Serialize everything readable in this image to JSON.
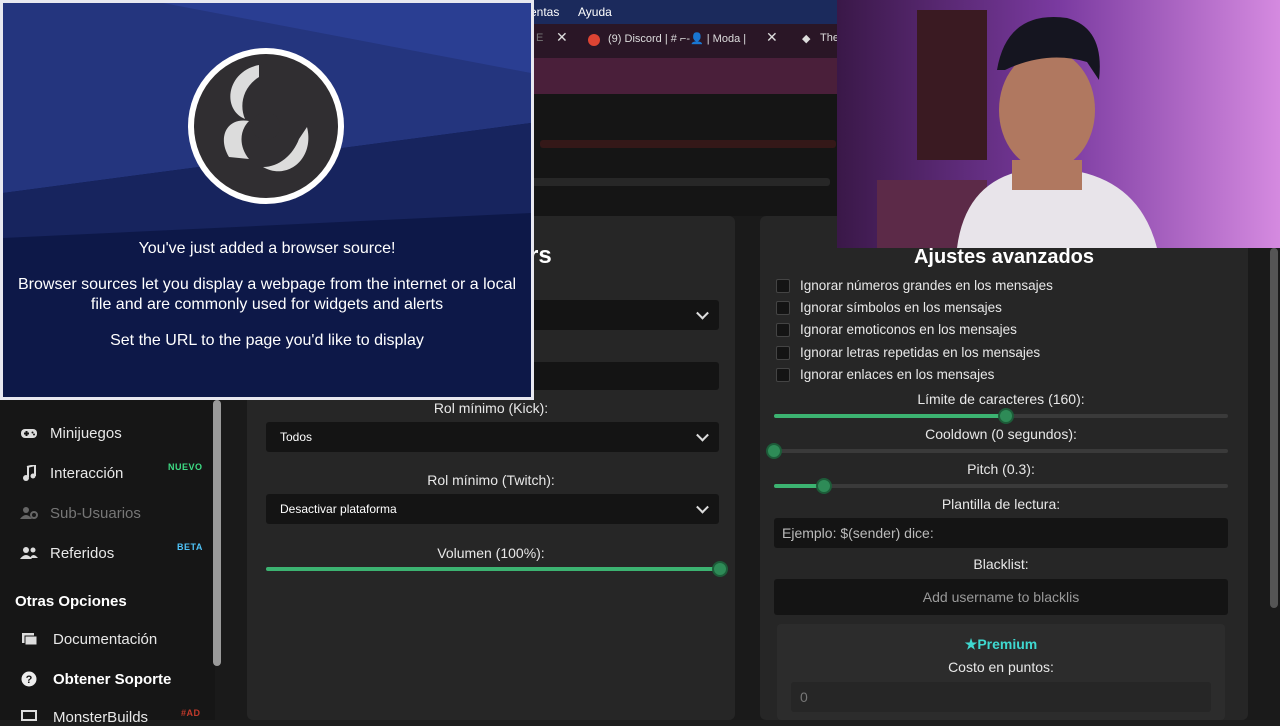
{
  "menubar": {
    "item1": "entas",
    "item2": "Ayuda"
  },
  "tabs": {
    "tab1": "E",
    "tab2": "(9) Discord | # ⌐-👤 | Moda |",
    "tab3": "The"
  },
  "sidebar": {
    "items": [
      {
        "label": "Minijuegos",
        "icon": "gamepad-icon"
      },
      {
        "label": "Interacción",
        "icon": "music-note-icon",
        "badge": "NUEVO"
      },
      {
        "label": "Sub-Usuarios",
        "icon": "users-cog-icon"
      },
      {
        "label": "Referidos",
        "icon": "user-friends-icon",
        "badge": "BETA"
      }
    ],
    "section_title": "Otras Opciones",
    "other": [
      {
        "label": "Documentación",
        "icon": "book-icon"
      },
      {
        "label": "Obtener Soporte",
        "icon": "question-circle-icon"
      },
      {
        "label": "MonsterBuilds",
        "icon": "monitor-icon",
        "badge": "#AD"
      }
    ]
  },
  "left": {
    "title_fragment": "rs",
    "rol_kick_label": "Rol mínimo (Kick):",
    "rol_kick_value": "Todos",
    "rol_twitch_label": "Rol mínimo (Twitch):",
    "rol_twitch_value": "Desactivar plataforma",
    "volume_label": "Volumen (100%):",
    "volume": 1.0
  },
  "right": {
    "title": "Ajustes avanzados",
    "checkboxes": [
      "Ignorar números grandes en los mensajes",
      "Ignorar símbolos en los mensajes",
      "Ignorar emoticonos en los mensajes",
      "Ignorar letras repetidas en los mensajes",
      "Ignorar enlaces en los mensajes"
    ],
    "limit_label": "Límite de caracteres (160):",
    "limit_fraction": 0.51,
    "cooldown_label": "Cooldown (0 segundos):",
    "cooldown_fraction": 0.0,
    "pitch_label": "Pitch (0.3):",
    "pitch_fraction": 0.11,
    "template_label": "Plantilla de lectura:",
    "template_placeholder": "Ejemplo: $(sender) dice:",
    "blacklist_label": "Blacklist:",
    "blacklist_placeholder": "Add username to blacklis",
    "premium_label": "Premium",
    "cost_label": "Costo en puntos:",
    "cost_value": "0"
  },
  "obs": {
    "line1": "You've just added a browser source!",
    "line2": "Browser sources let you display a webpage from the internet or a local file and are commonly used for widgets and alerts",
    "line3": "Set the URL to the page you'd like to display"
  },
  "colors": {
    "accent_green": "#3cb371",
    "badge_new": "#3ddc84",
    "badge_beta": "#4fc3f7",
    "premium": "#3fd8d0",
    "obs_bg": "#0d1848"
  }
}
